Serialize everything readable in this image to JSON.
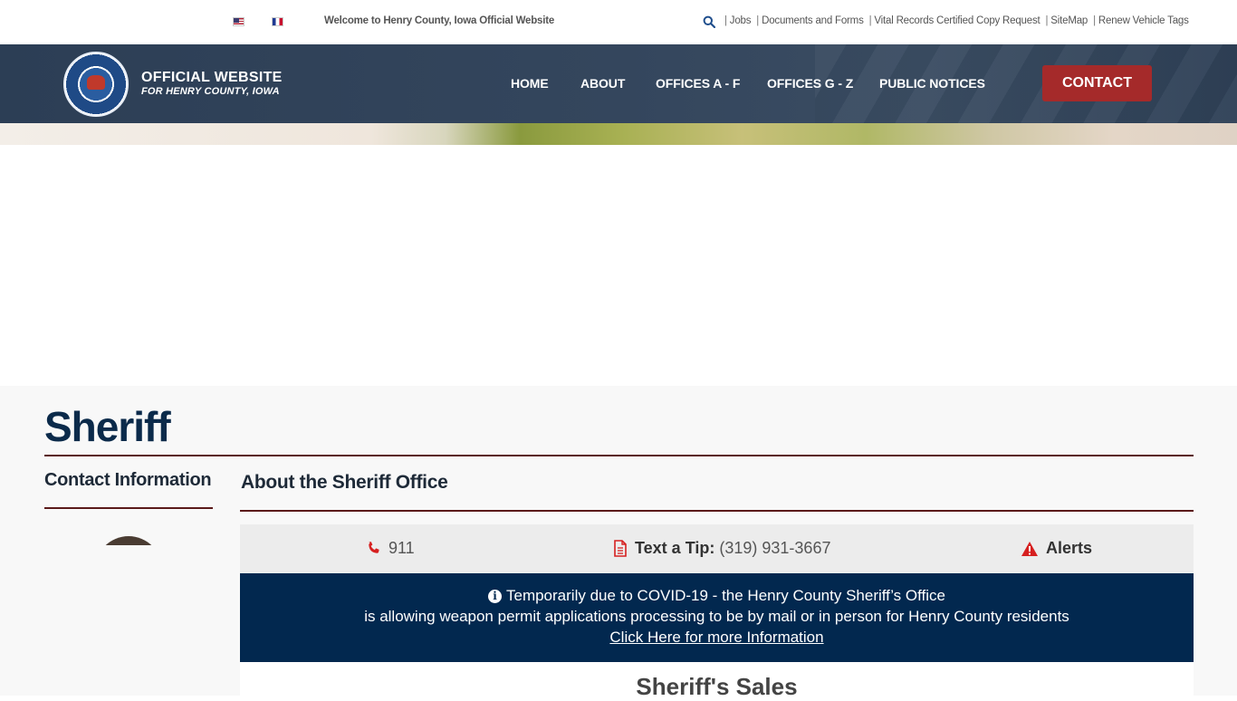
{
  "topbar": {
    "welcome": "Welcome to Henry County, Iowa Official Website",
    "links": [
      "Jobs",
      "Documents and Forms",
      "Vital Records Certified Copy Request",
      "SiteMap",
      "Renew Vehicle Tags"
    ]
  },
  "header": {
    "logo_title": "OFFICIAL WEBSITE",
    "logo_subtitle": "FOR HENRY COUNTY, IOWA",
    "nav": [
      "HOME",
      "ABOUT",
      "OFFICES A - F",
      "OFFICES G - Z",
      "PUBLIC NOTICES"
    ],
    "contact_label": "CONTACT"
  },
  "page": {
    "title": "Sheriff",
    "sidebar_title": "Contact Information",
    "main_title": "About the Sheriff Office"
  },
  "info_bar": {
    "phone": "911",
    "tip_label": "Text a Tip:",
    "tip_number": "(319) 931-3667",
    "alerts": "Alerts"
  },
  "notice": {
    "line1": "Temporarily due to COVID-19 - the Henry County Sheriff’s Office",
    "line2": "is allowing weapon permit applications processing to be by mail or in person for Henry County residents",
    "link": "Click Here for more Information"
  },
  "sales": {
    "title": "Sheriff's Sales"
  },
  "colors": {
    "header_bg": "#34465d",
    "contact_button": "#a52a2a",
    "notice_bg": "#02284f",
    "rule": "#5a1a1a",
    "title": "#0b2a4a"
  }
}
